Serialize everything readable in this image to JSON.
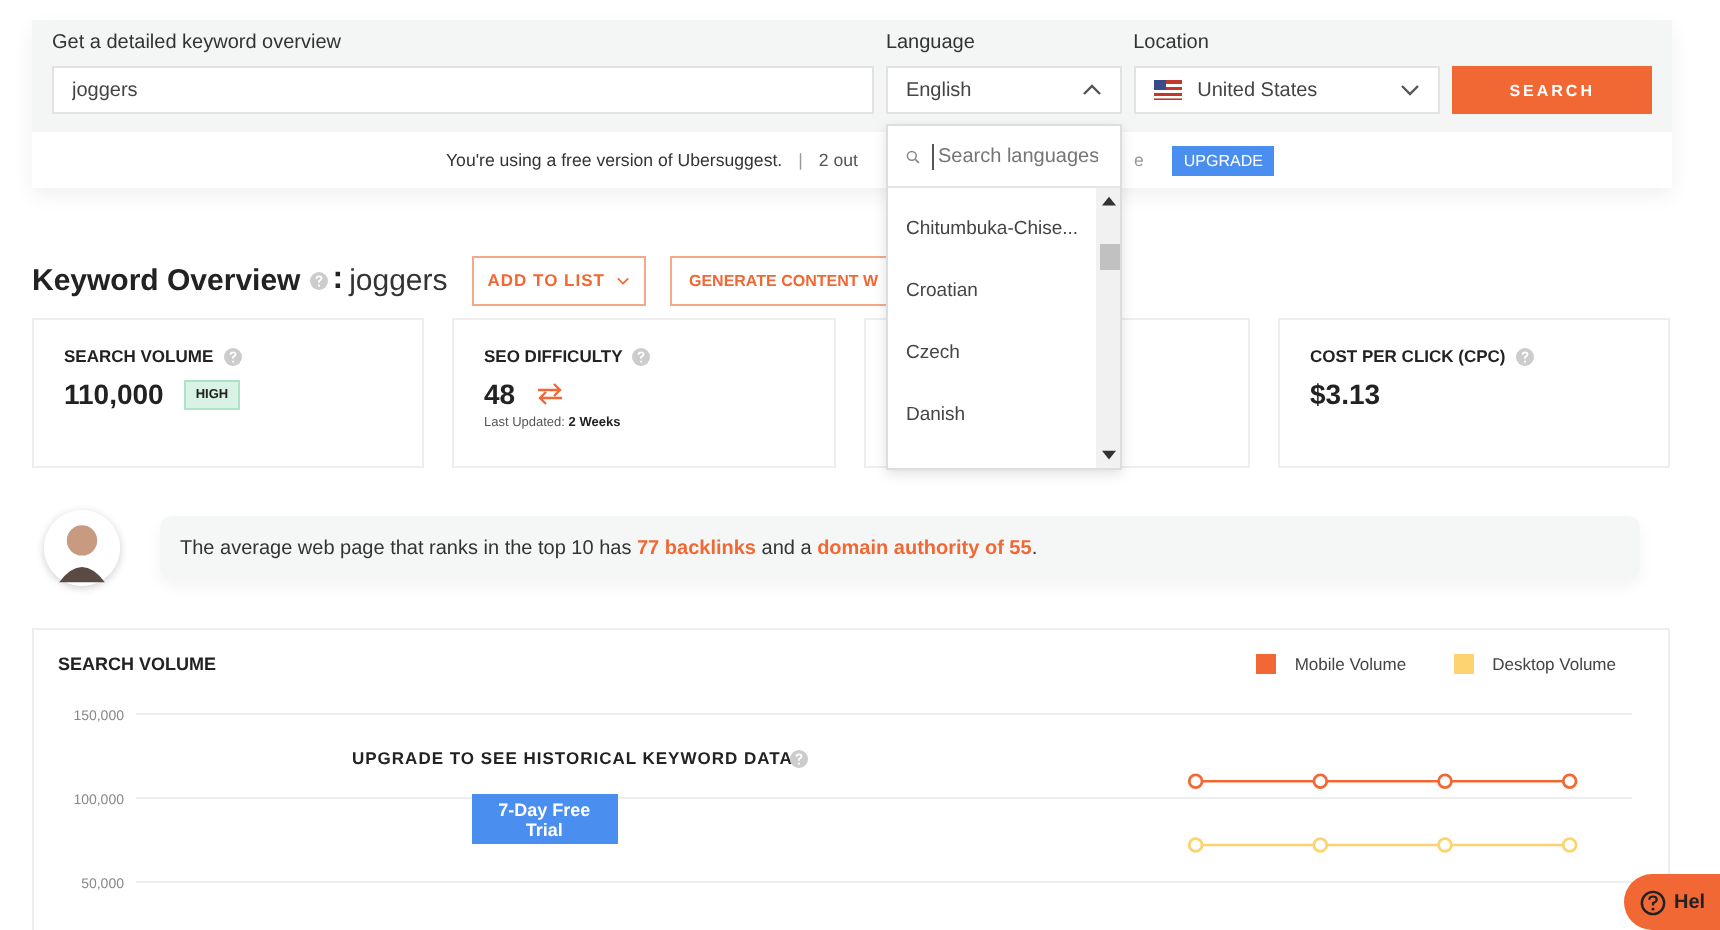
{
  "search_panel": {
    "keyword": {
      "label": "Get a detailed keyword overview",
      "value": "joggers"
    },
    "language": {
      "label": "Language",
      "value": "English",
      "expanded": true
    },
    "location": {
      "label": "Location",
      "value": "United States",
      "expanded": false
    },
    "search_button": "SEARCH"
  },
  "notice": {
    "text": "You're using a free version of Ubersuggest.",
    "separator": "|",
    "count_text": "2 out",
    "tail_text": "e",
    "upgrade_button": "UPGRADE"
  },
  "language_dropdown": {
    "placeholder": "Search languages",
    "items": [
      {
        "label": "Chitumbuka-Chise...",
        "selected": false
      },
      {
        "label": "Croatian",
        "selected": false
      },
      {
        "label": "Czech",
        "selected": false
      },
      {
        "label": "Danish",
        "selected": false
      }
    ]
  },
  "overview": {
    "title": "Keyword Overview",
    "separator": ":",
    "keyword": "joggers",
    "add_to_list": "ADD TO LIST",
    "generate_content": "GENERATE CONTENT W"
  },
  "metrics": [
    {
      "kind": "volume",
      "label": "SEARCH VOLUME",
      "value": "110,000",
      "badge": "HIGH"
    },
    {
      "kind": "difficulty",
      "label": "SEO DIFFICULTY",
      "value": "48",
      "updated_label": "Last Updated:",
      "updated_value": "2 Weeks"
    },
    {
      "kind": "hidden"
    },
    {
      "kind": "cpc",
      "label": "COST PER CLICK (CPC)",
      "value": "$3.13"
    }
  ],
  "insight": {
    "text": "The average web page that ranks in the top 10 has **77 backlinks** and a **domain authority of 55**."
  },
  "volume_chart": {
    "title": "SEARCH VOLUME",
    "upgrade_text": "UPGRADE TO SEE HISTORICAL KEYWORD DATA",
    "trial_button": "7-Day Free Trial",
    "chart_data": {
      "type": "line",
      "categories": [
        null,
        null,
        null,
        null,
        null,
        null,
        null,
        null,
        null,
        null,
        null,
        null
      ],
      "ylim": [
        50000,
        150000
      ],
      "yticks": [
        {
          "value": 50000,
          "label": "50,000"
        },
        {
          "value": 100000,
          "label": "100,000"
        },
        {
          "value": 150000,
          "label": "150,000"
        }
      ],
      "series": [
        {
          "name": "Mobile Volume",
          "color": "#f26835",
          "marker": "circle",
          "values": [
            null,
            null,
            null,
            null,
            null,
            null,
            null,
            null,
            110000,
            110000,
            110000,
            110000
          ]
        },
        {
          "name": "Desktop Volume",
          "color": "#fdd36f",
          "marker": "circle",
          "values": [
            null,
            null,
            null,
            null,
            null,
            null,
            null,
            null,
            72000,
            72000,
            72000,
            72000
          ]
        }
      ]
    }
  },
  "help_button": "Hel"
}
